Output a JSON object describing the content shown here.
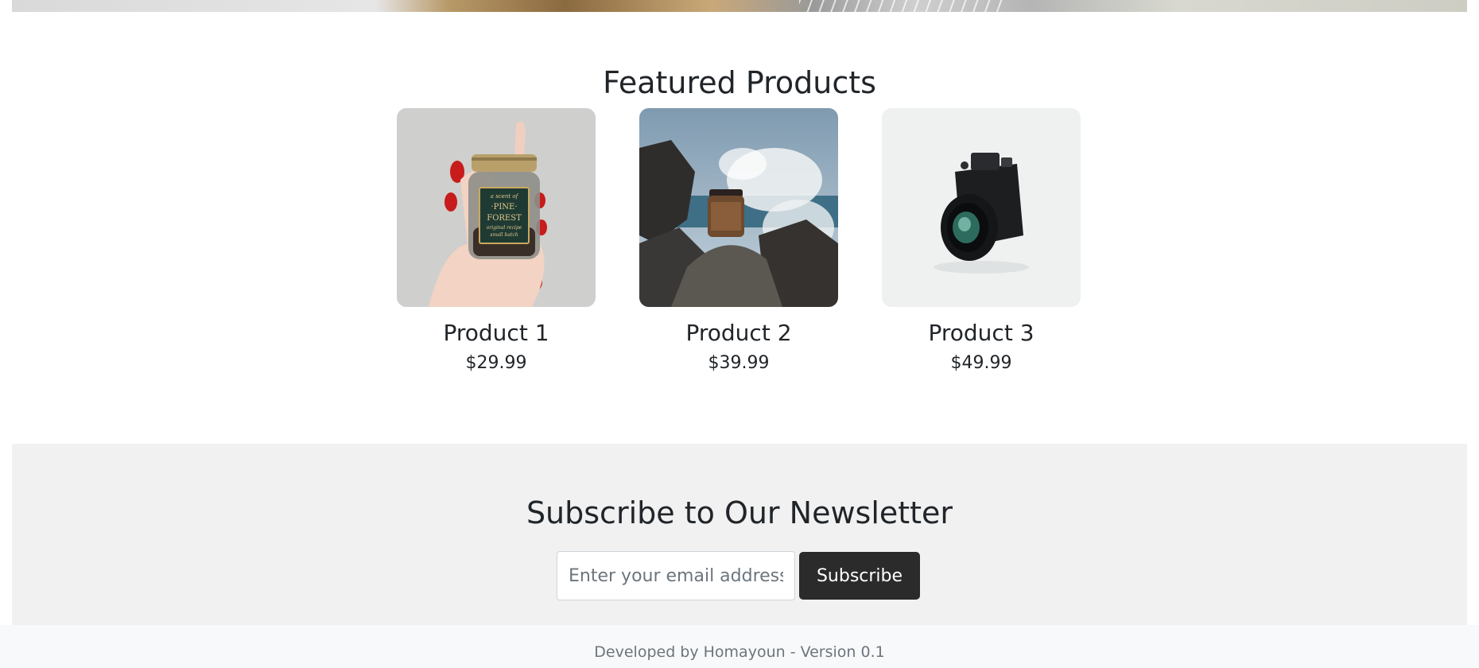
{
  "featured": {
    "title": "Featured Products",
    "products": [
      {
        "name": "Product 1",
        "price": "$29.99",
        "image_icon": "jar-in-hand-photo",
        "jar_label_line1": "a scent of",
        "jar_label_line2": "·PINE·",
        "jar_label_line3": "FOREST",
        "jar_label_line4": "original recipe",
        "jar_label_line5": "small batch"
      },
      {
        "name": "Product 2",
        "price": "$39.99",
        "image_icon": "jar-on-rocks-photo"
      },
      {
        "name": "Product 3",
        "price": "$49.99",
        "image_icon": "camera-photo"
      }
    ]
  },
  "newsletter": {
    "title": "Subscribe to Our Newsletter",
    "email_placeholder": "Enter your email address",
    "email_value": "",
    "subscribe_label": "Subscribe"
  },
  "footer": {
    "text": "Developed by Homayoun - Version 0.1"
  },
  "colors": {
    "button_bg": "#2b2b2b",
    "newsletter_bg": "#f1f1f1",
    "footer_bg": "#f8f9fa",
    "text_dark": "#212529",
    "text_muted": "#6c757d"
  }
}
